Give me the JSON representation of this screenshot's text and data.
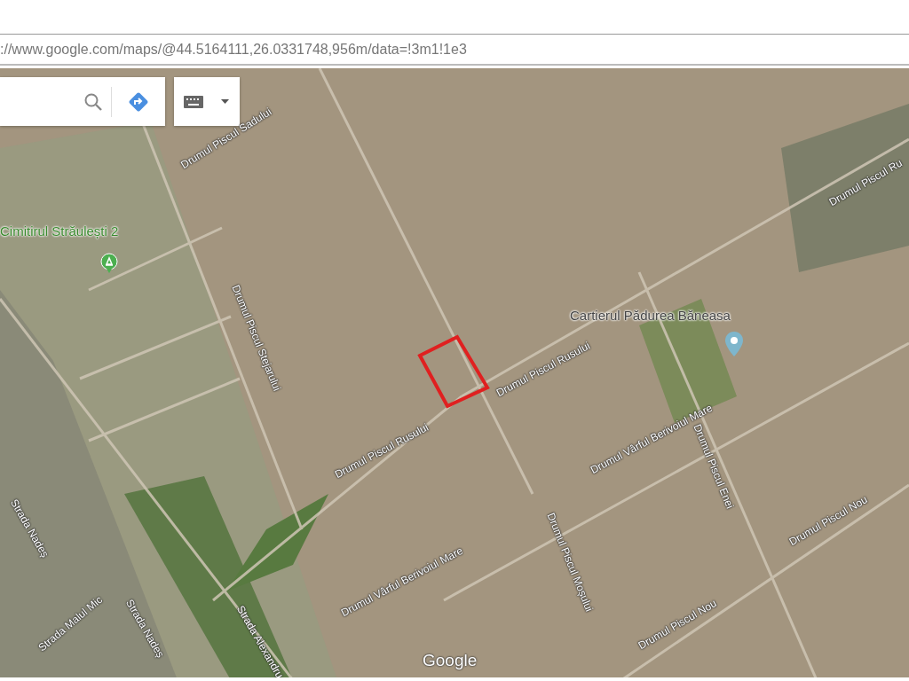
{
  "browser": {
    "url": "://www.google.com/maps/@44.5164111,26.0331748,956m/data=!3m1!1e3"
  },
  "map": {
    "labels": [
      {
        "text": "Drumul Piscul Sadului",
        "kind": "road"
      },
      {
        "text": "Cimitirul Străulești 2",
        "kind": "park"
      },
      {
        "text": "Drumul Piscul Stejarului",
        "kind": "road"
      },
      {
        "text": "Drumul Piscul Rusului",
        "kind": "road"
      },
      {
        "text": "Drumul Piscul Rusului",
        "kind": "road"
      },
      {
        "text": "Cartierul Pădurea Băneasa",
        "kind": "place"
      },
      {
        "text": "Drumul Vârful Berivoiul Mare",
        "kind": "road"
      },
      {
        "text": "Drumul Piscul Enei",
        "kind": "road"
      },
      {
        "text": "Drumul Vârful Berivoiul Mare",
        "kind": "road"
      },
      {
        "text": "Drumul Piscul Moșului",
        "kind": "road"
      },
      {
        "text": "Drumul Piscul Nou",
        "kind": "road"
      },
      {
        "text": "Drumul Piscul Nou",
        "kind": "road"
      },
      {
        "text": "Drumul Piscul Ru",
        "kind": "road"
      },
      {
        "text": "Strada Nadeș",
        "kind": "road"
      },
      {
        "text": "Strada Malul Mic",
        "kind": "road"
      },
      {
        "text": "Strada Nadeș",
        "kind": "road"
      },
      {
        "text": "Strada Alexandru",
        "kind": "road"
      }
    ],
    "attribution": "Google"
  }
}
